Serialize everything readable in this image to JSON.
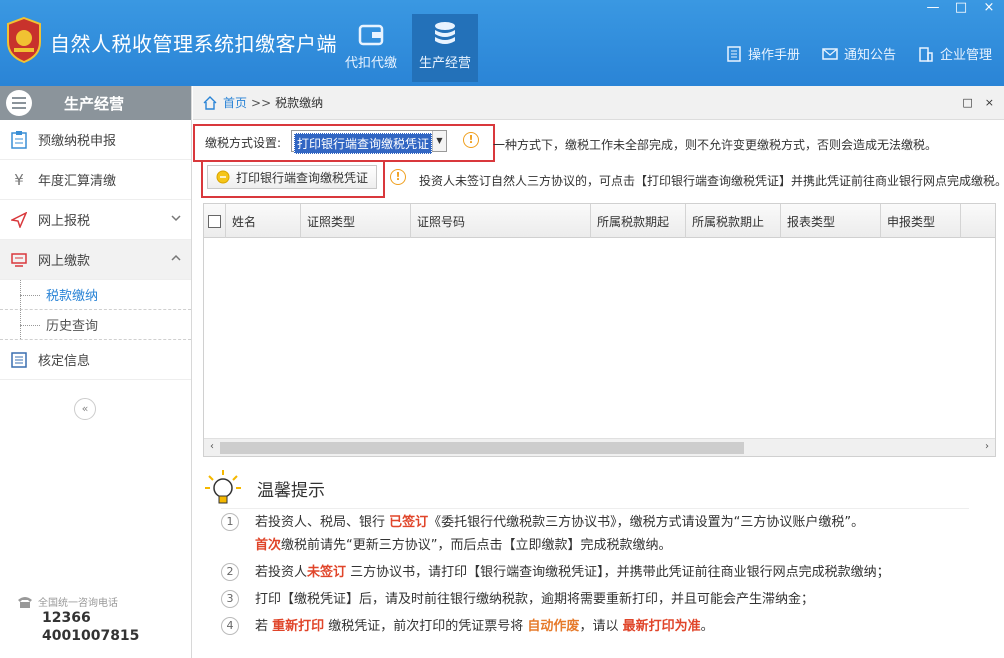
{
  "app": {
    "title": "自然人税收管理系统扣缴客户端"
  },
  "nav_tabs": [
    {
      "label": "代扣代缴",
      "icon": "wallet-icon"
    },
    {
      "label": "生产经营",
      "icon": "coins-stack-icon"
    }
  ],
  "top_links": [
    {
      "label": "操作手册",
      "icon": "manual-icon"
    },
    {
      "label": "通知公告",
      "icon": "mail-icon"
    },
    {
      "label": "企业管理",
      "icon": "building-icon"
    }
  ],
  "window_controls": [
    "—",
    "□",
    "×"
  ],
  "sidebar": {
    "header": "生产经营",
    "items": [
      {
        "label": "预缴纳税申报",
        "icon": "clipboard-icon"
      },
      {
        "label": "年度汇算清缴",
        "icon": "yen-icon"
      },
      {
        "label": "网上报税",
        "icon": "send-icon"
      },
      {
        "label": "网上缴款",
        "icon": "monitor-icon"
      },
      {
        "label": "核定信息",
        "icon": "list-icon"
      }
    ],
    "sub_items": [
      "税款缴纳",
      "历史查询"
    ],
    "collapse": "«",
    "hotline_label": "全国统一咨询电话",
    "hotline_numbers": [
      "12366",
      "4001007815"
    ]
  },
  "breadcrumb": {
    "home": "首页",
    "sep": ">>",
    "current": "税款缴纳",
    "controls": [
      "□",
      "×"
    ]
  },
  "settings": {
    "label": "缴税方式设置:",
    "selected": "打印银行端查询缴税凭证",
    "note": "一种方式下，缴税工作未全部完成，则不允许变更缴税方式，否则会造成无法缴税。",
    "warn_symbol": "!"
  },
  "print": {
    "button_label": "打印银行端查询缴税凭证",
    "note": "投资人未签订自然人三方协议的，可点击【打印银行端查询缴税凭证】并携此凭证前往商业银行网点完成缴税。"
  },
  "table": {
    "columns": [
      "姓名",
      "证照类型",
      "证照号码",
      "所属税款期起",
      "所属税款期止",
      "报表类型",
      "申报类型"
    ],
    "rows": [],
    "scroll_left": "‹",
    "scroll_right": "›"
  },
  "tips": {
    "title": "温馨提示",
    "items": [
      {
        "num": "1",
        "parts": [
          {
            "t": "若投资人、税局、银行 "
          },
          {
            "t": "已签订",
            "c": "red"
          },
          {
            "t": "《委托银行代缴税款三方协议书》，缴税方式请设置为“三方协议账户缴税”。"
          }
        ],
        "parts2": [
          {
            "t": "首次",
            "c": "red"
          },
          {
            "t": "缴税前请先“更新三方协议”，而后点击【立即缴款】完成税款缴纳。"
          }
        ]
      },
      {
        "num": "2",
        "parts": [
          {
            "t": "若投资人"
          },
          {
            "t": "未签订",
            "c": "red"
          },
          {
            "t": " 三方协议书，请打印【银行端查询缴税凭证】，并携带此凭证前往商业银行网点完成税款缴纳；"
          }
        ]
      },
      {
        "num": "3",
        "parts": [
          {
            "t": "打印【缴税凭证】后，请及时前往银行缴纳税款，逾期将需要重新打印，并且可能会产生滞纳金；"
          }
        ]
      },
      {
        "num": "4",
        "parts": [
          {
            "t": "若 "
          },
          {
            "t": "重新打印",
            "c": "red"
          },
          {
            "t": " 缴税凭证，前次打印的凭证票号将 "
          },
          {
            "t": "自动作废",
            "c": "orange"
          },
          {
            "t": "，请以 "
          },
          {
            "t": "最新打印为准",
            "c": "red"
          },
          {
            "t": "。"
          }
        ]
      }
    ]
  },
  "colors": {
    "header_blue": "#2a84d6",
    "highlight_red": "#d9383c",
    "link_blue": "#2a84d6"
  }
}
